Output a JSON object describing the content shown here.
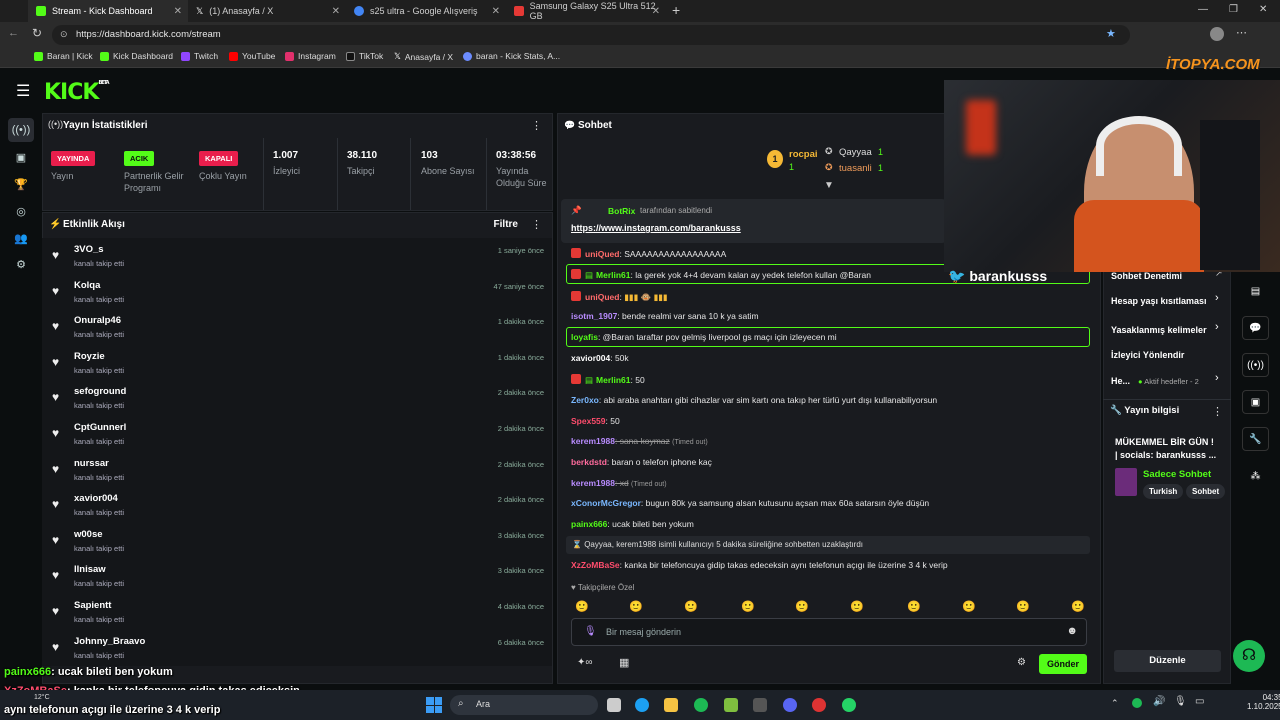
{
  "browser": {
    "tabs": [
      {
        "label": "Stream - Kick Dashboard",
        "icon": "kick-icon",
        "color": "#53fc18"
      },
      {
        "label": "(1) Anasayfa / X",
        "icon": "x-icon",
        "color": "#000000"
      },
      {
        "label": "s25 ultra - Google Alışveriş",
        "icon": "google-icon",
        "color": "#4285f4"
      },
      {
        "label": "Samsung Galaxy S25 Ultra 512 GB",
        "icon": "store-icon",
        "color": "#e53935"
      }
    ],
    "url": "https://dashboard.kick.com/stream",
    "bookmarks": [
      "Baran | Kick",
      "Kick Dashboard",
      "Twitch",
      "YouTube",
      "Instagram",
      "TikTok",
      "Anasayfa / X",
      "baran - Kick Stats, A..."
    ]
  },
  "brand": {
    "logo": "KICK",
    "beta": "BETA",
    "accent": "#53fc18"
  },
  "stats": {
    "title": "Yayın İstatistikleri",
    "items": [
      {
        "badge": "YAYINDA",
        "label": "Yayın"
      },
      {
        "badge": "ACIK",
        "label": "Partnerlik Gelir Programı"
      },
      {
        "badge": "KAPALI",
        "label": "Çoklu Yayın"
      },
      {
        "value": "1.007",
        "label": "İzleyici"
      },
      {
        "value": "38.110",
        "label": "Takipçi"
      },
      {
        "value": "103",
        "label": "Abone Sayısı"
      },
      {
        "value": "03:38:56",
        "label": "Yayında Olduğu Süre"
      }
    ]
  },
  "activity": {
    "title": "Etkinlik Akışı",
    "filter": "Filtre",
    "events": [
      {
        "name": "3VO_s",
        "sub": "kanalı takip etti",
        "time": "1 saniye önce"
      },
      {
        "name": "Kolqa",
        "sub": "kanalı takip etti",
        "time": "47 saniye önce"
      },
      {
        "name": "Onuralp46",
        "sub": "kanalı takip etti",
        "time": "1 dakika önce"
      },
      {
        "name": "Royzie",
        "sub": "kanalı takip etti",
        "time": "1 dakika önce"
      },
      {
        "name": "sefoground",
        "sub": "kanalı takip etti",
        "time": "2 dakika önce"
      },
      {
        "name": "CptGunnerl",
        "sub": "kanalı takip etti",
        "time": "2 dakika önce"
      },
      {
        "name": "nurssar",
        "sub": "kanalı takip etti",
        "time": "2 dakika önce"
      },
      {
        "name": "xavior004",
        "sub": "kanalı takip etti",
        "time": "2 dakika önce"
      },
      {
        "name": "w00se",
        "sub": "kanalı takip etti",
        "time": "3 dakika önce"
      },
      {
        "name": "llnisaw",
        "sub": "kanalı takip etti",
        "time": "3 dakika önce"
      },
      {
        "name": "Sapientt",
        "sub": "kanalı takip etti",
        "time": "4 dakika önce"
      },
      {
        "name": "Johnny_Braavo",
        "sub": "kanalı takip etti",
        "time": "6 dakika önce"
      }
    ]
  },
  "chat": {
    "title": "Sohbet",
    "leaders": [
      {
        "rank": "1",
        "name": "rocpai",
        "count": "1"
      },
      {
        "name": "Qayyaa",
        "count": "1"
      },
      {
        "name": "tuasanli",
        "count": "1"
      }
    ],
    "pinned_by": "BotRix",
    "pinned_suffix": "tarafından sabitlendi",
    "pinned_link": "https://www.instagram.com/barankusss",
    "messages": [
      {
        "user": "uniQued",
        "text": ": SAAAAAAAAAAAAAAAAA",
        "color": "#ff6b6b"
      },
      {
        "user": "Merlin61",
        "text": ": la gerek yok 4+4 devam kalan ay yedek telefon kullan @Baran",
        "color": "#53fc18"
      },
      {
        "user": "uniQued",
        "text": ":",
        "color": "#ff6b6b"
      },
      {
        "user": "isotm_1907",
        "text": ": bende realmi var sana 10 k ya satim",
        "color": "#b98cff"
      },
      {
        "user": "loyafis",
        "text": ": @Baran taraftar pov gelmiş liverpool gs maçı için izleyecen mi",
        "color": "#53fc18"
      },
      {
        "user": "xavior004",
        "text": ": 50k",
        "color": "#ffffff"
      },
      {
        "user": "Merlin61",
        "text": ": 50",
        "color": "#53fc18"
      },
      {
        "user": "Zer0xo",
        "text": ": abi araba anahtarı gibi cihazlar var sim kartı ona takıp her türlü yurt dışı kullanabiliyorsun",
        "color": "#7ab8ff"
      },
      {
        "user": "Spex559",
        "text": ": 50",
        "color": "#ff4d6d"
      },
      {
        "user": "kerem1988",
        "text": ": sana koymaz",
        "note": "(Timed out)",
        "color": "#b98cff"
      },
      {
        "user": "berkdstd",
        "text": ": baran o telefon iphone kaç",
        "color": "#ff6b9d"
      },
      {
        "user": "kerem1988",
        "text": ": xd",
        "note": "(Timed out)",
        "color": "#b98cff"
      },
      {
        "user": "xConorMcGregor",
        "text": ": bugun 80k ya samsung alsan kutusunu açsan max 60a satarsın öyle düşün",
        "color": "#7ab8ff"
      },
      {
        "user": "painx666",
        "text": ": ucak bileti ben yokum",
        "color": "#53fc18"
      },
      {
        "user": "XzZoMBaSe",
        "text": ": kanka bir telefoncuya gidip takas edeceksin aynı telefonun açıgı ile üzerine 3 4 k verip",
        "color": "#ff4d6d"
      }
    ],
    "system": "Qayyaa, kerem1988 isimli kullanıcıyı 5 dakika süreliğine sohbetten uzaklaştırdı",
    "followers_only": "Takipçilere Özel",
    "input_placeholder": "Bir mesaj gönderin",
    "send": "Gönder"
  },
  "right_panel": {
    "items": [
      "Sohbet Denetimi",
      "Hesap yaşı kısıtlaması",
      "Yasaklanmış kelimeler",
      "İzleyici Yönlendir",
      "He..."
    ],
    "active_goals": "Aktif hedefler - 2",
    "stream_info_title": "Yayın bilgisi",
    "stream_title": "MÜKEMMEL BİR GÜN !",
    "socials": "| socials: barankusss ...",
    "category": "Sadece Sohbet",
    "tags": [
      "Turkish",
      "Sohbet"
    ],
    "edit": "Düzenle"
  },
  "webcam": {
    "handle": "barankusss",
    "watermark": "İTOPYA.COM"
  },
  "overlay": {
    "line1_user": "painx666",
    "line1_text": ": ucak bileti ben yokum",
    "line2_user": "XzZoMBaSe",
    "line2_text": ": kanka bir telefoncuya gidip takas ediceksin",
    "line3_text": "aynı telefonun açıgı ile üzerine 3 4 k verip"
  },
  "taskbar": {
    "weather": "12°C",
    "search": "Ara",
    "time": "04:35",
    "date": "1.10.2025"
  }
}
